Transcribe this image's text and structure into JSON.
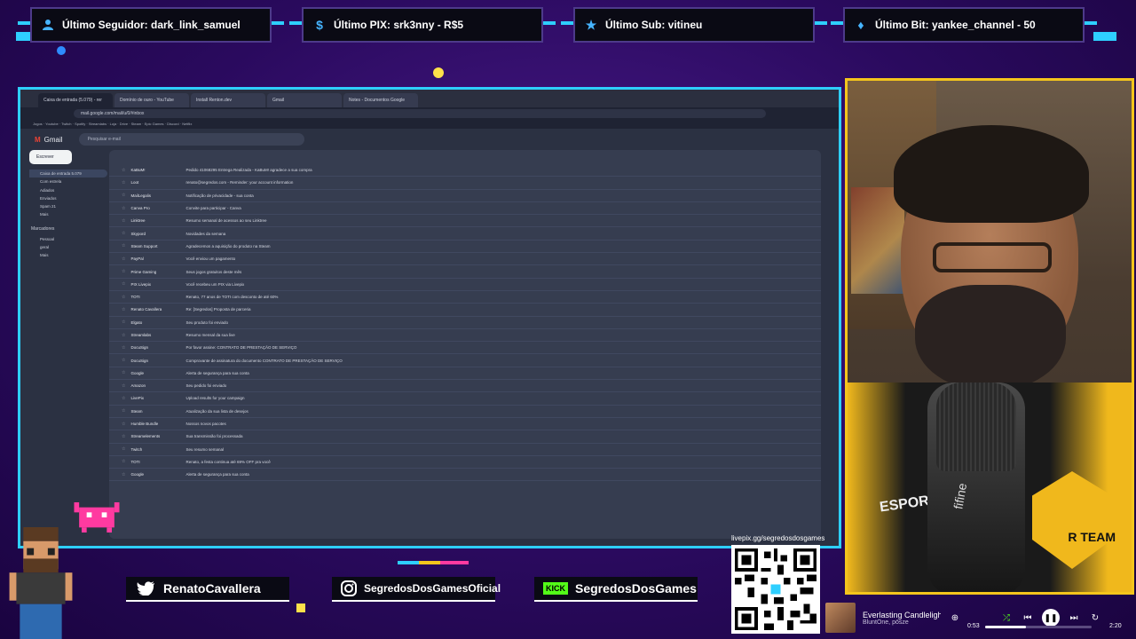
{
  "alerts": [
    {
      "label": "Último Seguidor: dark_link_samuel",
      "icon": "person-icon"
    },
    {
      "label": "Último PIX: srk3nny - R$5",
      "icon": "dollar-icon"
    },
    {
      "label": "Último Sub: vitineu",
      "icon": "star-icon"
    },
    {
      "label": "Último Bit: yankee_channel - 50",
      "icon": "diamond-icon"
    }
  ],
  "screen": {
    "tabs": [
      "Caixa de entrada (5.079) - rer",
      "Domínio de ouro - YouTube",
      "Install Renton.dev",
      "Gmail",
      "Notes - Documentos Google"
    ],
    "url": "mail.google.com/mail/u/0/#inbox",
    "bookmarks": "Jogos · Youtube · Twitch · Spotify · Streamlabs · Loja · Drive · Steam · Epic Games · Discord · Netflix",
    "gmail": {
      "app_name": "Gmail",
      "search_placeholder": "Pesquisar e-mail",
      "compose_label": "Escrever",
      "sidebar": [
        {
          "label": "Caixa de entrada",
          "count": "5.079",
          "active": true
        },
        {
          "label": "Com estrela",
          "count": ""
        },
        {
          "label": "Adiados",
          "count": ""
        },
        {
          "label": "Enviados",
          "count": ""
        },
        {
          "label": "Spam",
          "count": "21"
        },
        {
          "label": "Mais",
          "count": ""
        }
      ],
      "labels_header": "Marcadores",
      "labels": [
        {
          "label": "Pessoal"
        },
        {
          "label": "geral"
        },
        {
          "label": "Mais"
        }
      ],
      "mails": [
        {
          "sender": "KaBuM!",
          "subject": "Pedido 41068295 Entrega Realizada - KaBuM! agradece a sua compra",
          "date": ""
        },
        {
          "sender": "Loot",
          "subject": "renato@segredos.com - Reminder: your account information",
          "date": ""
        },
        {
          "sender": "MailLegalis",
          "subject": "Notificação de privacidade - sua conta",
          "date": ""
        },
        {
          "sender": "Canva Pro",
          "subject": "Convite para participar - Canva",
          "date": ""
        },
        {
          "sender": "Linktree",
          "subject": "Resumo semanal de acessos ao seu Linktree",
          "date": ""
        },
        {
          "sender": "Skypord",
          "subject": "Novidades da semana",
          "date": ""
        },
        {
          "sender": "Steam Support",
          "subject": "Agradecemos a aquisição do produto na Steam",
          "date": ""
        },
        {
          "sender": "PayPal",
          "subject": "Você enviou um pagamento",
          "date": ""
        },
        {
          "sender": "Prime Gaming",
          "subject": "Seus jogos gratuitos deste mês",
          "date": ""
        },
        {
          "sender": "PIX Livepix",
          "subject": "Você recebeu um PIX via Livepix",
          "date": ""
        },
        {
          "sender": "TOTI",
          "subject": "Renato, 77 anos de TOTI com desconto de até 60%",
          "date": ""
        },
        {
          "sender": "Renato Cavallera",
          "subject": "Re: [Segredos] Proposta de parceria",
          "date": ""
        },
        {
          "sender": "Elgato",
          "subject": "Seu produto foi enviado",
          "date": ""
        },
        {
          "sender": "Streamlabs",
          "subject": "Resumo mensal da sua live",
          "date": ""
        },
        {
          "sender": "DocuSign",
          "subject": "Por favor assine: CONTRATO DE PRESTAÇÃO DE SERVIÇO",
          "date": ""
        },
        {
          "sender": "DocuSign",
          "subject": "Comprovante de assinatura do documento CONTRATO DE PRESTAÇÃO DE SERVIÇO",
          "date": ""
        },
        {
          "sender": "Google",
          "subject": "Alerta de segurança para sua conta",
          "date": ""
        },
        {
          "sender": "Amazon",
          "subject": "Seu pedido foi enviado",
          "date": ""
        },
        {
          "sender": "LivePix",
          "subject": "Upload results for your campaign",
          "date": ""
        },
        {
          "sender": "Steam",
          "subject": "Atualização da sua lista de desejos",
          "date": ""
        },
        {
          "sender": "Humble Bundle",
          "subject": "Nossos novos pacotes",
          "date": ""
        },
        {
          "sender": "Streamelements",
          "subject": "Sua transmissão foi processada",
          "date": ""
        },
        {
          "sender": "Twitch",
          "subject": "Seu resumo semanal",
          "date": ""
        },
        {
          "sender": "TOTI",
          "subject": "Renato, a festa continua até 69% OFF pra você",
          "date": ""
        },
        {
          "sender": "Google",
          "subject": "Alerta de segurança para sua conta",
          "date": ""
        }
      ]
    }
  },
  "social": [
    {
      "label": "RenatoCavallera",
      "icon": "twitter-icon"
    },
    {
      "label": "SegredosDosGamesOficial",
      "icon": "instagram-icon"
    },
    {
      "label": "SegredosDosGames",
      "icon": "kick-icon",
      "tag": "KICK"
    }
  ],
  "qr": {
    "url": "livepix.gg/segredosdosgames"
  },
  "music": {
    "title": "Everlasting Candlelight",
    "artist": "BluntOne, pösze",
    "elapsed": "0:53",
    "duration": "2:20",
    "progress": 0.38
  }
}
